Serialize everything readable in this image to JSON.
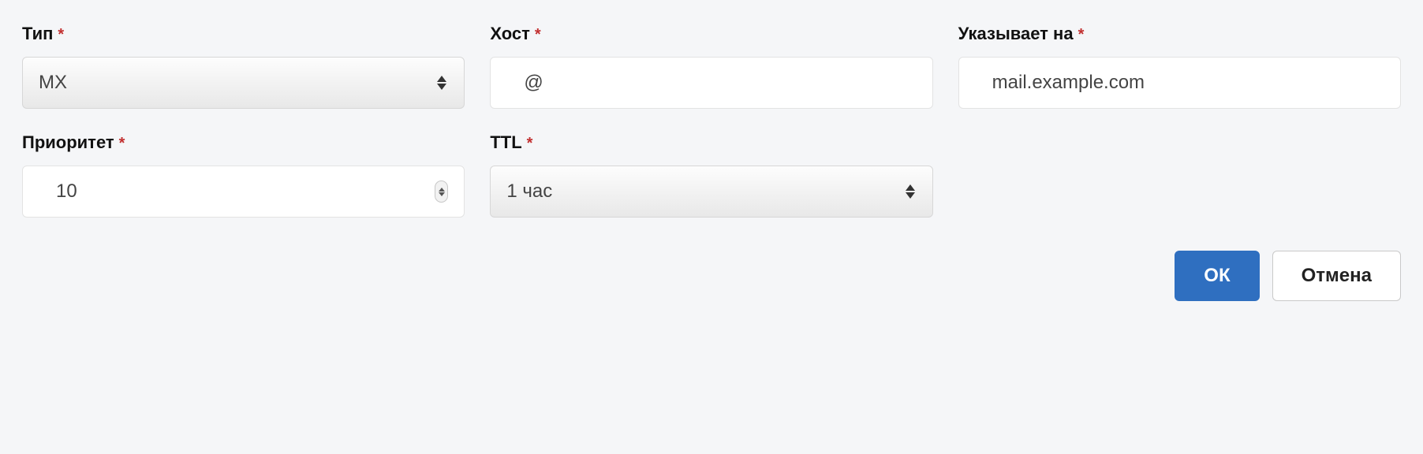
{
  "fields": {
    "type": {
      "label": "Тип",
      "value": "MX"
    },
    "host": {
      "label": "Хост",
      "value": "@"
    },
    "points": {
      "label": "Указывает на",
      "value": "mail.example.com"
    },
    "priority": {
      "label": "Приоритет",
      "value": "10"
    },
    "ttl": {
      "label": "TTL",
      "value": "1 час"
    }
  },
  "required_mark": "*",
  "buttons": {
    "ok": "ОК",
    "cancel": "Отмена"
  }
}
